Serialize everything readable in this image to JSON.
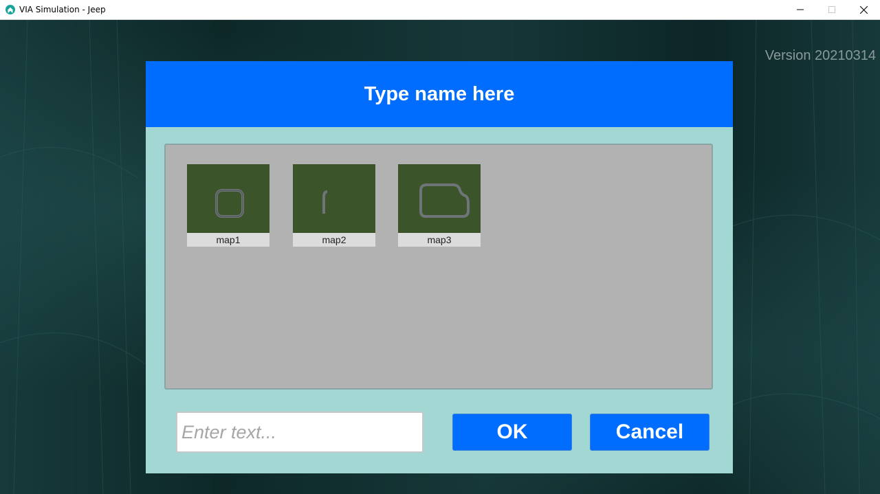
{
  "window": {
    "title": "VIA Simulation - Jeep",
    "icon": "app-logo-icon",
    "controls": [
      "minimize-icon",
      "maximize-icon",
      "close-icon"
    ]
  },
  "version_label": "Version 20210314",
  "dialog": {
    "title": "Type name here",
    "maps": [
      {
        "label": "map1",
        "shape": "rounded-square-track"
      },
      {
        "label": "map2",
        "shape": "short-curve-track"
      },
      {
        "label": "map3",
        "shape": "folder-shaped-track"
      }
    ],
    "input": {
      "value": "",
      "placeholder": "Enter text..."
    },
    "ok_label": "OK",
    "cancel_label": "Cancel"
  },
  "colors": {
    "header": "#006dff",
    "dialog_bg": "#a2d7d4",
    "panel_bg": "#b2b2b2",
    "map_green": "#3b5429",
    "button": "#006dff"
  }
}
